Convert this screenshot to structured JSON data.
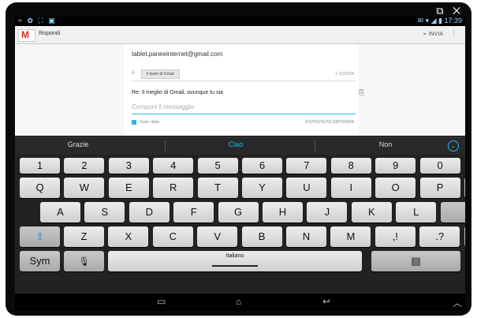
{
  "window_icons": "⧉ ✕",
  "status": {
    "left_icons": "≈ ✿ ⛶ ▣",
    "right": "✉ ▾ ◢ ▮ 17:39"
  },
  "actionbar": {
    "title": "Rispondi",
    "send_label": "INVIA",
    "menu_icon": "⋮"
  },
  "compose": {
    "from": "tablet.paneeinternet@gmail.com",
    "to_prefix": "A",
    "to_chip": "Il team di Gmail",
    "ccbcc": "+ CC/CCN",
    "subject": "Re: Il meglio di Gmail, ovunque tu sia",
    "body_placeholder": "Componi il messaggio",
    "quote_label": "Testo citato",
    "quote_right": "RISPOSTA INCORPORATA"
  },
  "suggestions": [
    "Grazie",
    "Ciao",
    "Non"
  ],
  "keyboard": {
    "row_numbers": [
      "1",
      "2",
      "3",
      "4",
      "5",
      "6",
      "7",
      "8",
      "9",
      "0"
    ],
    "row_q": [
      "Q",
      "W",
      "E",
      "R",
      "T",
      "Y",
      "U",
      "I",
      "O",
      "P"
    ],
    "row_a": [
      "A",
      "S",
      "D",
      "F",
      "G",
      "H",
      "J",
      "K",
      "L"
    ],
    "row_z": [
      "Z",
      "X",
      "C",
      "V",
      "B",
      "N",
      "M",
      ",!",
      ".?"
    ],
    "sym": "Sym",
    "space_label": "Italiano",
    "backspace": "⌫",
    "enter": "↵",
    "shift": "⇧",
    "mic": "🎙",
    "clipboard": "▤"
  },
  "navbar": {
    "recent": "▭",
    "home": "⌂",
    "back": "↩",
    "up": "︿"
  }
}
